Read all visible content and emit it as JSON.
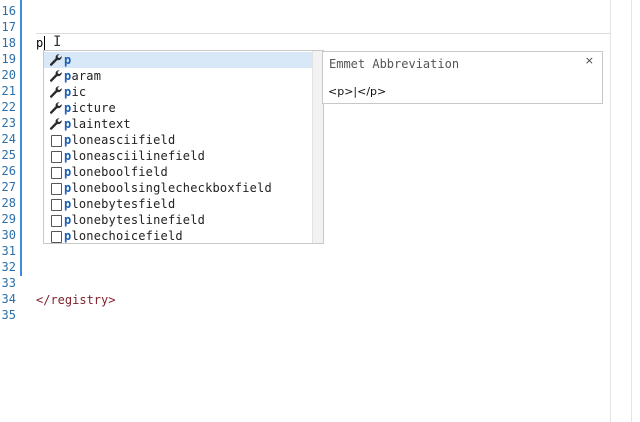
{
  "editor": {
    "line_numbers": [
      "16",
      "17",
      "18",
      "19",
      "20",
      "21",
      "22",
      "23",
      "24",
      "25",
      "26",
      "27",
      "28",
      "29",
      "30",
      "31",
      "32",
      "33",
      "34",
      "35"
    ],
    "current_line_text": "p",
    "closing_tag": "</registry>",
    "text_cursor_glyph": "I"
  },
  "autocomplete": {
    "typed_prefix": "p",
    "items": [
      {
        "rest": "",
        "icon": "wrench-icon",
        "selected": true
      },
      {
        "rest": "aram",
        "icon": "wrench-icon",
        "selected": false
      },
      {
        "rest": "ic",
        "icon": "wrench-icon",
        "selected": false
      },
      {
        "rest": "icture",
        "icon": "wrench-icon",
        "selected": false
      },
      {
        "rest": "laintext",
        "icon": "wrench-icon",
        "selected": false
      },
      {
        "rest": "loneasciifield",
        "icon": "file-icon",
        "selected": false
      },
      {
        "rest": "loneasciilinefield",
        "icon": "file-icon",
        "selected": false
      },
      {
        "rest": "loneboolfield",
        "icon": "file-icon",
        "selected": false
      },
      {
        "rest": "loneboolsinglecheckboxfield",
        "icon": "file-icon",
        "selected": false
      },
      {
        "rest": "lonebytesfield",
        "icon": "file-icon",
        "selected": false
      },
      {
        "rest": "lonebyteslinefield",
        "icon": "file-icon",
        "selected": false
      },
      {
        "rest": "lonechoicefield",
        "icon": "file-icon",
        "selected": false
      }
    ]
  },
  "doc_popup": {
    "title": "Emmet Abbreviation",
    "close_glyph": "×",
    "body": "<p>|</p>"
  },
  "colors": {
    "line_number": "#2b6ea8",
    "gutter_bar": "#3d8be0",
    "match_highlight": "#1a5fb4",
    "selected_row": "#d8e8f8",
    "closing_tag": "#7f1f2a"
  }
}
